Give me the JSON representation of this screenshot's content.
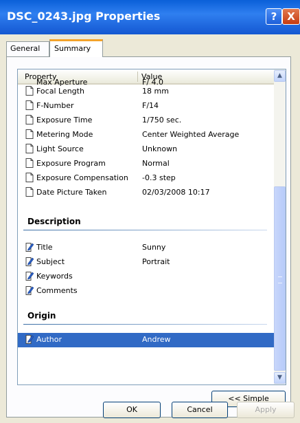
{
  "window": {
    "title": "DSC_0243.jpg Properties"
  },
  "titlebar": {
    "help": "?",
    "close": "X"
  },
  "tabs": [
    {
      "label": "General"
    },
    {
      "label": "Summary"
    }
  ],
  "list": {
    "headers": {
      "property": "Property",
      "value": "Value"
    },
    "partial_row": {
      "label": "Max Aperture",
      "value": "F/ 4.0"
    },
    "rows": [
      {
        "label": "Focal Length",
        "value": "18 mm"
      },
      {
        "label": "F-Number",
        "value": "F/14"
      },
      {
        "label": "Exposure Time",
        "value": "1/750 sec."
      },
      {
        "label": "Metering Mode",
        "value": "Center Weighted Average"
      },
      {
        "label": "Light Source",
        "value": "Unknown"
      },
      {
        "label": "Exposure Program",
        "value": "Normal"
      },
      {
        "label": "Exposure Compensation",
        "value": "-0.3 step"
      },
      {
        "label": "Date Picture Taken",
        "value": "02/03/2008 10:17"
      }
    ],
    "description": {
      "heading": "Description",
      "rows": [
        {
          "label": "Title",
          "value": "Sunny"
        },
        {
          "label": "Subject",
          "value": "Portrait"
        },
        {
          "label": "Keywords",
          "value": ""
        },
        {
          "label": "Comments",
          "value": ""
        }
      ]
    },
    "origin": {
      "heading": "Origin",
      "rows": [
        {
          "label": "Author",
          "value": "Andrew"
        }
      ]
    }
  },
  "buttons": {
    "simple": "<< Simple",
    "ok": "OK",
    "cancel": "Cancel",
    "apply": "Apply"
  },
  "colors": {
    "titlebar": "#0a5fd8",
    "selection": "#316ac5",
    "tab_highlight": "#f3a32a"
  }
}
